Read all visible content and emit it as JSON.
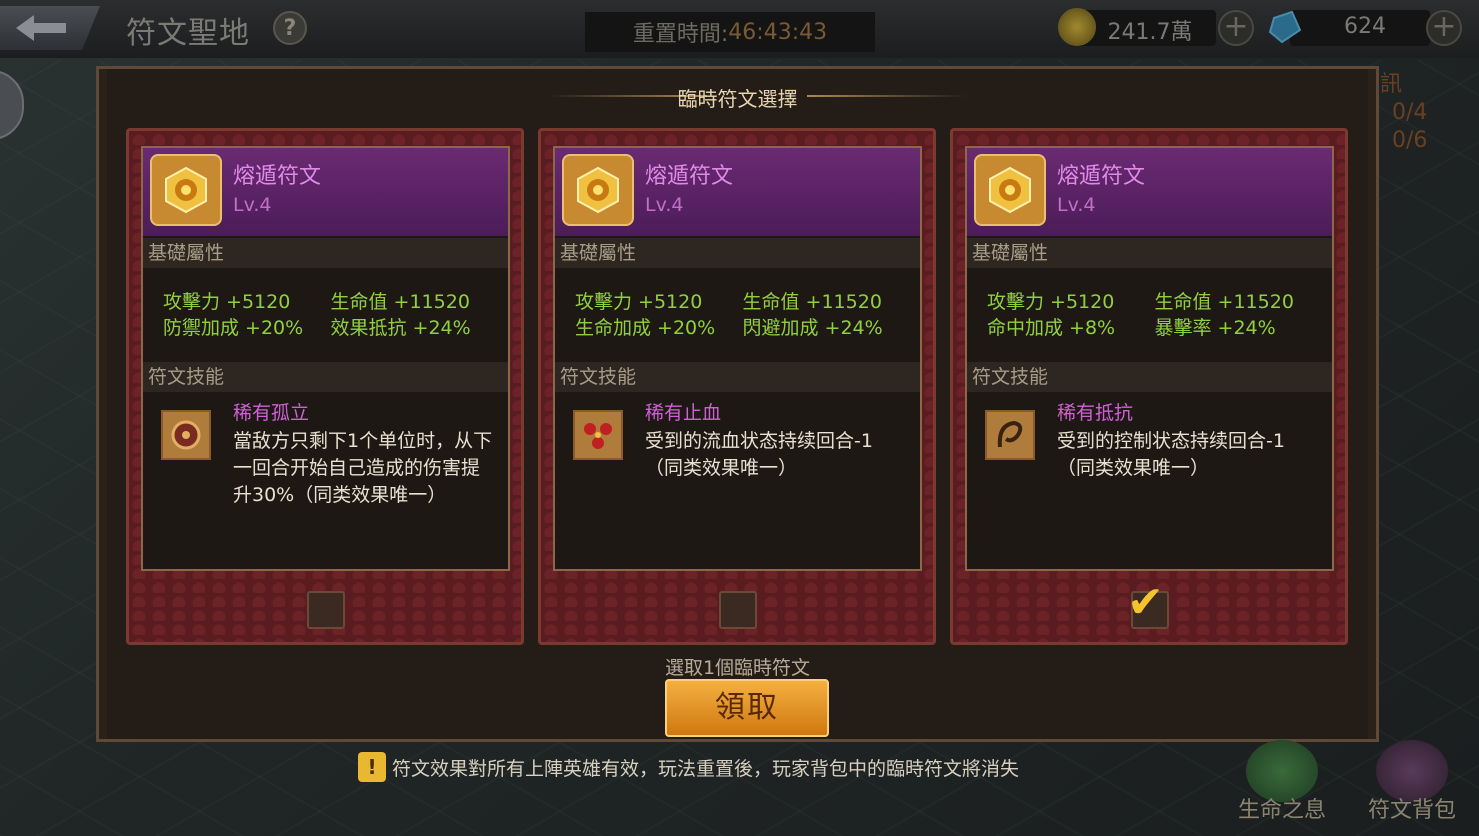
{
  "header": {
    "title": "符文聖地",
    "help": "?",
    "reset_label": "重置時間:",
    "reset_value": "46:43:43",
    "gold_value": "241.7萬",
    "gem_value": "624",
    "plus": "+"
  },
  "side_peek": {
    "tab": "訊",
    "count1": "0/4",
    "count2": "0/6"
  },
  "modal": {
    "title": "臨時符文選擇",
    "section_basic": "基礎屬性",
    "section_skill": "符文技能",
    "cards": [
      {
        "name": "熔遁符文",
        "level": "Lv.4",
        "stats": [
          "攻擊力 +5120",
          "生命值 +11520",
          "防禦加成 +20%",
          "效果抵抗 +24%"
        ],
        "skill_name": "稀有孤立",
        "skill_desc": "當敌方只剩下1个单位时，从下一回合开始自己造成的伤害提升30%（同类效果唯一）",
        "skill_icon": "shield-skill-icon",
        "checked": false
      },
      {
        "name": "熔遁符文",
        "level": "Lv.4",
        "stats": [
          "攻擊力 +5120",
          "生命值 +11520",
          "生命加成 +20%",
          "閃避加成 +24%"
        ],
        "skill_name": "稀有止血",
        "skill_desc": "受到的流血状态持续回合-1（同类效果唯一）",
        "skill_icon": "blood-skill-icon",
        "checked": false
      },
      {
        "name": "熔遁符文",
        "level": "Lv.4",
        "stats": [
          "攻擊力 +5120",
          "生命值 +11520",
          "命中加成 +8%",
          "暴擊率 +24%"
        ],
        "skill_name": "稀有抵抗",
        "skill_desc": "受到的控制状态持续回合-1（同类效果唯一）",
        "skill_icon": "whip-skill-icon",
        "checked": true
      }
    ],
    "hint": "選取1個臨時符文",
    "claim_button": "領取"
  },
  "notice": {
    "icon": "!",
    "text": "符文效果對所有上陣英雄有效，玩法重置後，玩家背包中的臨時符文將消失"
  },
  "bottom": {
    "life_label": "生命之息",
    "bag_label": "符文背包"
  },
  "colors": {
    "accent_gold": "#f4b040",
    "purple_header": "#6a2a72",
    "stat_green": "#90d040",
    "skill_name": "#d060d8"
  }
}
